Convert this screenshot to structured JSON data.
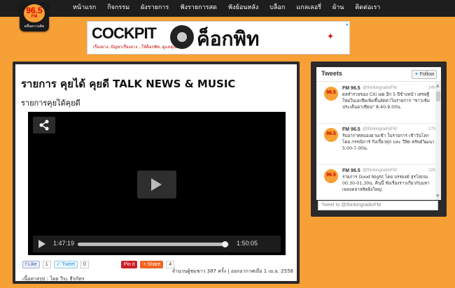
{
  "logo": {
    "number": "96.5",
    "fm": "FM",
    "tagline": "คลื่นความคิด"
  },
  "nav": [
    "หน้าแรก",
    "กิจกรรม",
    "ผังรายการ",
    "ฟังรายการสด",
    "ฟังย้อนหลัง",
    "บล็อก",
    "แกลเลอรี่",
    "ผ้าน",
    "ติดต่อเรา"
  ],
  "banner": {
    "brand": "COCKPIT",
    "brand_thai": "ค็อกพิท",
    "sub": "เรื่องยาง..ปัญหาเรื่องยาง ..ให้ค็อกพิท..ดูแลคุณ"
  },
  "main": {
    "title": "รายการ คุยได้ คุยดี TALK NEWS & MUSIC",
    "subtitle": "รายการคุยได้คุยดี",
    "player": {
      "current_time": "1:47:19",
      "duration": "1:50:05",
      "progress": 0.975
    },
    "social": {
      "like": "Like",
      "like_count": "1",
      "tweet": "Tweet",
      "tweet_count": "0",
      "pin": "Pin it",
      "share": "Share",
      "share_count": "4"
    },
    "stats": "จำนวนผู้ชมชาว 387 ครั้ง | ออกอากาศเมื่อ 1 เม.ย. 2558",
    "author": "เนื้อหาสรุป : โดย วีระ ธีรภัทร"
  },
  "twitter": {
    "title": "Tweets",
    "follow": "Follow",
    "input_placeholder": "Tweet to @thinkingradioFM",
    "tweets": [
      {
        "name": "FM 96.5",
        "handle": "@thinkingradioFM",
        "time": "14h",
        "text": "ผลสำรวจของ Citi เผย อีก 5 ปีข้างหน้า เศรษฐีใหม่ในเอเชียเพิ่มขึ้นอัตตาในรายการ \"ชาวเช้มประเด็นอาเซียน\" 8.40-9.00น."
      },
      {
        "name": "FM 96.5",
        "handle": "@thinkingradioFM",
        "time": "17h",
        "text": "รับอากาศสมองยามเช้า ในรายการ เช้าวันโลก โดย กรรณิการ์ กิ่งเกี้ยวทุก และ วีสิต ทรัพย์วิฒนา 5.00-7.00น."
      },
      {
        "name": "FM 96.5",
        "handle": "@thinkingradioFM",
        "time": "22h",
        "text": "รายการ Good Night โดย บรรยงค์ สุรโสภณ 00.30-01.30น. คืนนี้ ฟังเรื่องราวเกี่ยวกับมหาเพลงคลาสสิคยิ่งใหญ่"
      }
    ]
  },
  "colors": {
    "page_bg": "#f7a035",
    "topbar": "#1e1e1e",
    "panel_border": "#2a2a2a"
  }
}
